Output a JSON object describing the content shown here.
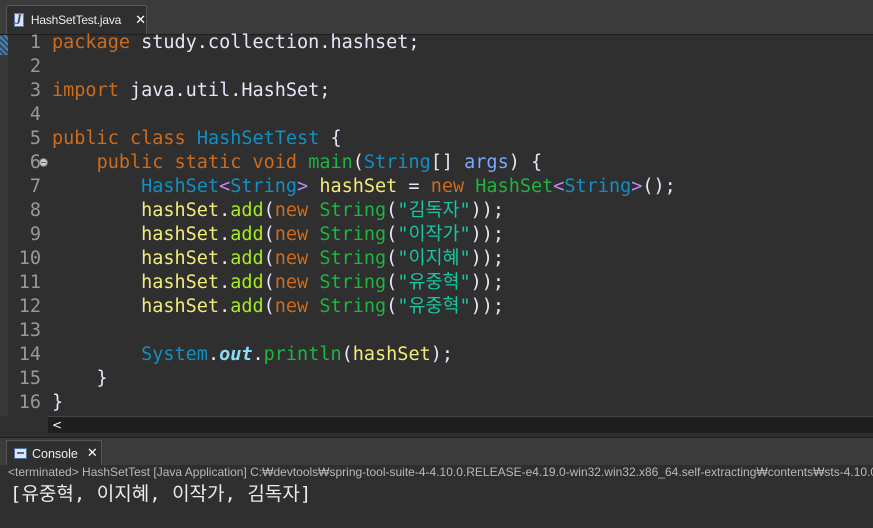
{
  "editor": {
    "tab": {
      "title": "HashSetTest.java",
      "close": "✕"
    },
    "scroll_arrow": "<",
    "lines": [
      {
        "n": "1",
        "parts": [
          [
            "kw",
            "package"
          ],
          [
            "pl",
            " study.collection.hashset;"
          ]
        ]
      },
      {
        "n": "2",
        "parts": []
      },
      {
        "n": "3",
        "parts": [
          [
            "kw",
            "import"
          ],
          [
            "pl",
            " java.util.HashSet;"
          ]
        ]
      },
      {
        "n": "4",
        "parts": []
      },
      {
        "n": "5",
        "parts": [
          [
            "kw",
            "public"
          ],
          [
            "pl",
            " "
          ],
          [
            "kw",
            "class"
          ],
          [
            "pl",
            " "
          ],
          [
            "typ",
            "HashSetTest"
          ],
          [
            "pl",
            " {"
          ]
        ]
      },
      {
        "n": "6",
        "fold": true,
        "parts": [
          [
            "pl",
            "    "
          ],
          [
            "kw",
            "public"
          ],
          [
            "pl",
            " "
          ],
          [
            "kw",
            "static"
          ],
          [
            "pl",
            " "
          ],
          [
            "kw",
            "void"
          ],
          [
            "pl",
            " "
          ],
          [
            "mth2",
            "main"
          ],
          [
            "pl",
            "("
          ],
          [
            "typ",
            "String"
          ],
          [
            "pl",
            "[] "
          ],
          [
            "par",
            "args"
          ],
          [
            "pl",
            ") {"
          ]
        ]
      },
      {
        "n": "7",
        "parts": [
          [
            "pl",
            "        "
          ],
          [
            "typ",
            "HashSet"
          ],
          [
            "ang",
            "<"
          ],
          [
            "typ",
            "String"
          ],
          [
            "ang",
            ">"
          ],
          [
            "pl",
            " "
          ],
          [
            "var",
            "hashSet"
          ],
          [
            "pl",
            " = "
          ],
          [
            "kw",
            "new"
          ],
          [
            "pl",
            " "
          ],
          [
            "cls",
            "HashSet"
          ],
          [
            "ang",
            "<"
          ],
          [
            "typ",
            "String"
          ],
          [
            "ang",
            ">"
          ],
          [
            "pl",
            "();"
          ]
        ]
      },
      {
        "n": "8",
        "parts": [
          [
            "pl",
            "        "
          ],
          [
            "var",
            "hashSet"
          ],
          [
            "pl",
            "."
          ],
          [
            "mth",
            "add"
          ],
          [
            "pl",
            "("
          ],
          [
            "kw",
            "new"
          ],
          [
            "pl",
            " "
          ],
          [
            "cls",
            "String"
          ],
          [
            "pl",
            "("
          ],
          [
            "str",
            "\"김독자\""
          ],
          [
            "pl",
            "));"
          ]
        ]
      },
      {
        "n": "9",
        "parts": [
          [
            "pl",
            "        "
          ],
          [
            "var",
            "hashSet"
          ],
          [
            "pl",
            "."
          ],
          [
            "mth",
            "add"
          ],
          [
            "pl",
            "("
          ],
          [
            "kw",
            "new"
          ],
          [
            "pl",
            " "
          ],
          [
            "cls",
            "String"
          ],
          [
            "pl",
            "("
          ],
          [
            "str",
            "\"이작가\""
          ],
          [
            "pl",
            "));"
          ]
        ]
      },
      {
        "n": "10",
        "parts": [
          [
            "pl",
            "        "
          ],
          [
            "var",
            "hashSet"
          ],
          [
            "pl",
            "."
          ],
          [
            "mth",
            "add"
          ],
          [
            "pl",
            "("
          ],
          [
            "kw",
            "new"
          ],
          [
            "pl",
            " "
          ],
          [
            "cls",
            "String"
          ],
          [
            "pl",
            "("
          ],
          [
            "str",
            "\"이지혜\""
          ],
          [
            "pl",
            "));"
          ]
        ]
      },
      {
        "n": "11",
        "parts": [
          [
            "pl",
            "        "
          ],
          [
            "var",
            "hashSet"
          ],
          [
            "pl",
            "."
          ],
          [
            "mth",
            "add"
          ],
          [
            "pl",
            "("
          ],
          [
            "kw",
            "new"
          ],
          [
            "pl",
            " "
          ],
          [
            "cls",
            "String"
          ],
          [
            "pl",
            "("
          ],
          [
            "str",
            "\"유중혁\""
          ],
          [
            "pl",
            "));"
          ]
        ]
      },
      {
        "n": "12",
        "parts": [
          [
            "pl",
            "        "
          ],
          [
            "var",
            "hashSet"
          ],
          [
            "pl",
            "."
          ],
          [
            "mth",
            "add"
          ],
          [
            "pl",
            "("
          ],
          [
            "kw",
            "new"
          ],
          [
            "pl",
            " "
          ],
          [
            "cls",
            "String"
          ],
          [
            "pl",
            "("
          ],
          [
            "str",
            "\"유중혁\""
          ],
          [
            "pl",
            "));"
          ]
        ]
      },
      {
        "n": "13",
        "parts": []
      },
      {
        "n": "14",
        "parts": [
          [
            "pl",
            "        "
          ],
          [
            "typ",
            "System"
          ],
          [
            "pl",
            "."
          ],
          [
            "sfld",
            "out"
          ],
          [
            "pl",
            "."
          ],
          [
            "mth3",
            "println"
          ],
          [
            "pl",
            "("
          ],
          [
            "var",
            "hashSet"
          ],
          [
            "pl",
            ");"
          ]
        ]
      },
      {
        "n": "15",
        "parts": [
          [
            "pl",
            "    }"
          ]
        ]
      },
      {
        "n": "16",
        "parts": [
          [
            "pl",
            "}"
          ]
        ]
      }
    ]
  },
  "console": {
    "tab": {
      "title": "Console",
      "close": "✕"
    },
    "terminated": "<terminated> HashSetTest [Java Application] C:₩devtools₩spring-tool-suite-4-4.10.0.RELEASE-e4.19.0-win32.win32.x86_64.self-extracting₩contents₩sts-4.10.0",
    "output": "[유중혁, 이지혜, 이작가, 김독자]"
  },
  "colors": {
    "background": "#2f2f2f",
    "keyword": "#cc6c1d",
    "type": "#1290c3",
    "class": "#1eb540",
    "variable": "#f3ec79",
    "string": "#17c6a3",
    "method": "#a7ec21",
    "static_field": "#8ddaf8"
  }
}
